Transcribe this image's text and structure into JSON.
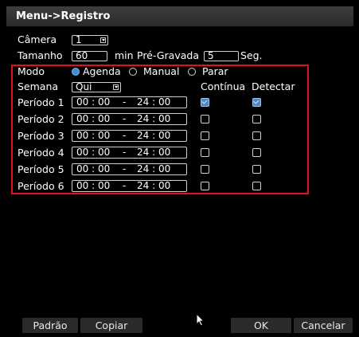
{
  "window": {
    "title": "Menu->Registro"
  },
  "camera": {
    "label": "Câmera",
    "value": "1"
  },
  "size": {
    "label": "Tamanho",
    "value": "60",
    "unit": "min",
    "prerecord_label": "Pré-Gravada",
    "prerecord_value": "5",
    "prerecord_unit": "Seg."
  },
  "mode": {
    "label": "Modo",
    "options": [
      "Agenda",
      "Manual",
      "Parar"
    ],
    "selected": "Agenda"
  },
  "week": {
    "label": "Semana",
    "value": "Qui"
  },
  "columns": {
    "continuous": "Contínua",
    "detect": "Detectar"
  },
  "periods": [
    {
      "label": "Período 1",
      "start": "00 : 00",
      "sep": "-",
      "end": "24 : 00",
      "continuous": true,
      "detect": true
    },
    {
      "label": "Período 2",
      "start": "00 : 00",
      "sep": "-",
      "end": "24 : 00",
      "continuous": false,
      "detect": false
    },
    {
      "label": "Período 3",
      "start": "00 : 00",
      "sep": "-",
      "end": "24 : 00",
      "continuous": false,
      "detect": false
    },
    {
      "label": "Período 4",
      "start": "00 : 00",
      "sep": "-",
      "end": "24 : 00",
      "continuous": false,
      "detect": false
    },
    {
      "label": "Período 5",
      "start": "00 : 00",
      "sep": "-",
      "end": "24 : 00",
      "continuous": false,
      "detect": false
    },
    {
      "label": "Período 6",
      "start": "00 : 00",
      "sep": "-",
      "end": "24 : 00",
      "continuous": false,
      "detect": false
    }
  ],
  "buttons": {
    "default": "Padrão",
    "copy": "Copiar",
    "ok": "OK",
    "cancel": "Cancelar"
  },
  "colors": {
    "highlight_border": "#e0121f",
    "radio_selected": "#3f8fd8",
    "checkbox_checked": "#4a86c9"
  }
}
